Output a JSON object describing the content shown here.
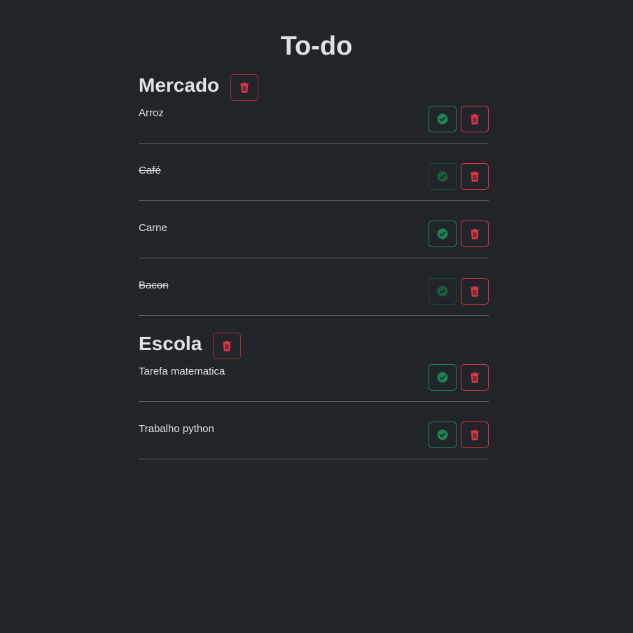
{
  "app": {
    "title": "To-do"
  },
  "colors": {
    "background": "#212529",
    "text": "#dee2e6",
    "success": "#198754",
    "success_faded": "#1d4a35",
    "danger": "#dc3545",
    "divider": "#5a5f64"
  },
  "icons": {
    "complete": "check-circle-icon",
    "delete": "trash-icon"
  },
  "lists": [
    {
      "title": "Mercado",
      "tasks": [
        {
          "text": "Arroz",
          "done": false
        },
        {
          "text": "Café",
          "done": true
        },
        {
          "text": "Carne",
          "done": false
        },
        {
          "text": "Bacon",
          "done": true
        }
      ]
    },
    {
      "title": "Escola",
      "tasks": [
        {
          "text": "Tarefa matematica",
          "done": false
        },
        {
          "text": "Trabalho python",
          "done": false
        }
      ]
    }
  ]
}
